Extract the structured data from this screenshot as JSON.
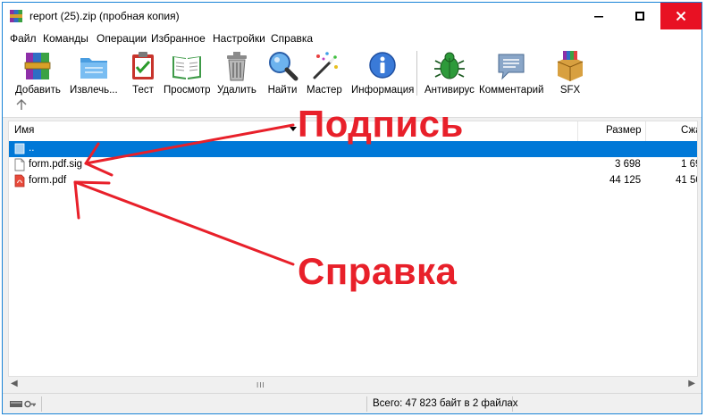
{
  "window": {
    "title": "report (25).zip (пробная копия)"
  },
  "menu": [
    "Файл",
    "Команды",
    "Операции",
    "Избранное",
    "Настройки",
    "Справка"
  ],
  "toolbar": {
    "add": "Добавить",
    "extract": "Извлечь...",
    "test": "Тест",
    "view": "Просмотр",
    "delete": "Удалить",
    "find": "Найти",
    "wizard": "Мастер",
    "info": "Информация",
    "antivirus": "Антивирус",
    "comment": "Комментарий",
    "sfx": "SFX"
  },
  "columns": {
    "name": "Имя",
    "size": "Размер",
    "packed": "Сжа"
  },
  "files": [
    {
      "name": "..",
      "size": "",
      "packed": ""
    },
    {
      "name": "form.pdf.sig",
      "size": "3 698",
      "packed": "1 69"
    },
    {
      "name": "form.pdf",
      "size": "44 125",
      "packed": "41 50"
    }
  ],
  "scrollbar": {
    "thumb": "III"
  },
  "status": {
    "text": "Всего: 47 823 байт в 2 файлах"
  },
  "annotations": {
    "signature": "Подпись",
    "reference": "Справка"
  },
  "colors": {
    "selection": "#0078d7",
    "close_button": "#e81123",
    "annotation": "#e8202a"
  }
}
